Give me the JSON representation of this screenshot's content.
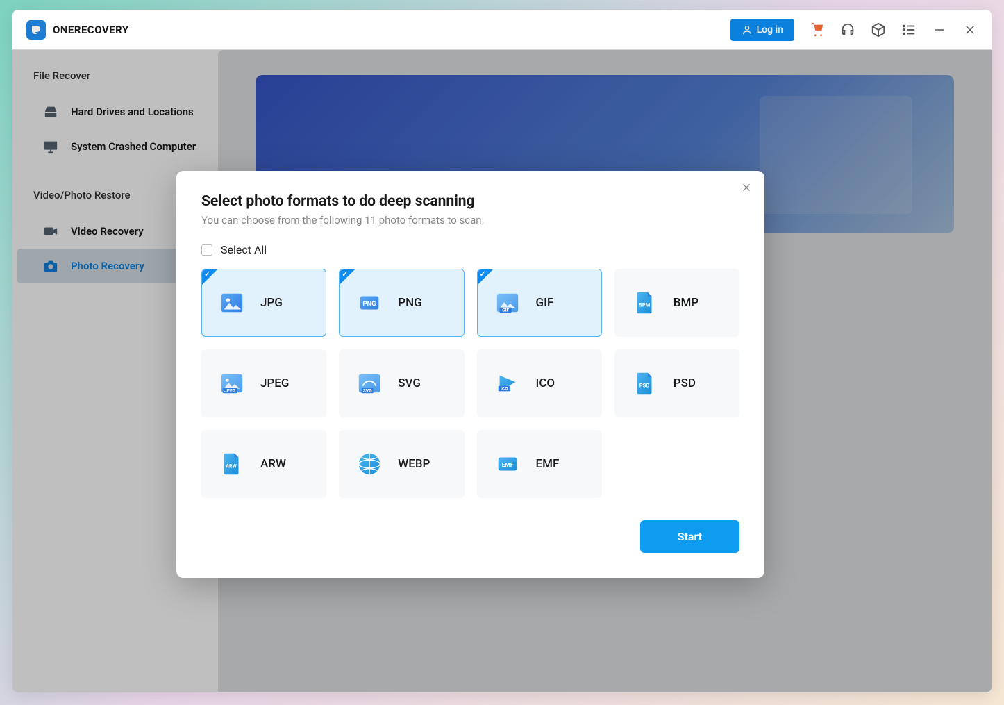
{
  "app": {
    "name": "ONERECOVERY",
    "login_label": "Log in"
  },
  "sidebar": {
    "section1_title": "File Recover",
    "section2_title": "Video/Photo Restore",
    "items": [
      {
        "label": "Hard Drives and Locations"
      },
      {
        "label": "System Crashed Computer"
      },
      {
        "label": "Video Recovery"
      },
      {
        "label": "Photo Recovery"
      }
    ]
  },
  "modal": {
    "title": "Select photo formats to do deep scanning",
    "subtitle": "You can choose from the following 11 photo formats to scan.",
    "select_all_label": "Select All",
    "start_label": "Start",
    "formats": [
      {
        "label": "JPG",
        "badge": "",
        "selected": true
      },
      {
        "label": "PNG",
        "badge": "PNG",
        "selected": true
      },
      {
        "label": "GIF",
        "badge": "GIF",
        "selected": true
      },
      {
        "label": "BMP",
        "badge": "BPM",
        "selected": false
      },
      {
        "label": "JPEG",
        "badge": "JPEG",
        "selected": false
      },
      {
        "label": "SVG",
        "badge": "SVG",
        "selected": false
      },
      {
        "label": "ICO",
        "badge": "ICO",
        "selected": false
      },
      {
        "label": "PSD",
        "badge": "PSD",
        "selected": false
      },
      {
        "label": "ARW",
        "badge": "ARW",
        "selected": false
      },
      {
        "label": "WEBP",
        "badge": "",
        "selected": false
      },
      {
        "label": "EMF",
        "badge": "EMF",
        "selected": false
      }
    ]
  },
  "colors": {
    "primary": "#0d8bf0",
    "accent": "#ff6b35"
  }
}
